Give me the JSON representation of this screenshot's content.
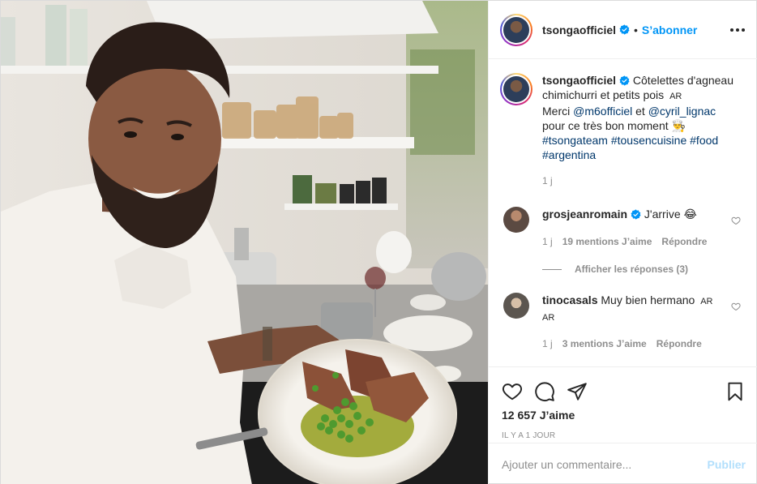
{
  "post": {
    "username": "tsongaofficiel",
    "follow_label": "S’abonner",
    "separator": "•"
  },
  "caption": {
    "username": "tsongaofficiel",
    "text_line1": "Côtelettes d'agneau chimichurri et petits pois",
    "flag1": "AR",
    "merci": "Merci",
    "mention1": "@m6officiel",
    "et": "et",
    "mention2": "@cyril_lignac",
    "text_line3": "pour ce très bon moment",
    "emoji": "👨‍🍳",
    "hashtags": [
      "#tsongateam",
      "#tousencuisine",
      "#food",
      "#argentina"
    ],
    "time": "1 j"
  },
  "comments": [
    {
      "username": "grosjeanromain",
      "text": "J'arrive",
      "emoji": "😂",
      "time": "1 j",
      "likes": "19 mentions J’aime",
      "reply": "Répondre",
      "view_replies": "Afficher les réponses (3)"
    },
    {
      "username": "tinocasals",
      "text": "Muy bien hermano",
      "flag1": "AR",
      "flag2": "AR",
      "time": "1 j",
      "likes": "3 mentions J’aime",
      "reply": "Répondre"
    }
  ],
  "footer": {
    "likes": "12 657 J’aime",
    "timestamp": "IL Y A 1 JOUR",
    "comment_placeholder": "Ajouter un commentaire...",
    "post_label": "Publier"
  },
  "icons": {
    "like": "heart-icon",
    "comment": "comment-bubble-icon",
    "share": "paper-plane-icon",
    "save": "bookmark-icon",
    "more": "more-options-icon",
    "verified": "verified-badge-icon"
  },
  "colors": {
    "link_blue": "#0095f6",
    "tag_blue": "#00376b",
    "muted": "#8e8e8e",
    "publish_disabled": "#b2dffc"
  }
}
